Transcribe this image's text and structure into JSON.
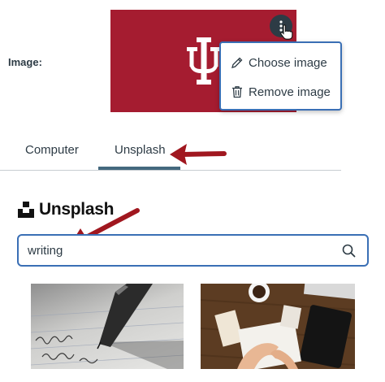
{
  "image_field": {
    "label": "Image:"
  },
  "preview": {
    "background_color": "#a51c30",
    "logo_icon": "iu-trident-logo"
  },
  "options_menu": {
    "trigger_icon": "kebab-icon",
    "items": [
      {
        "label": "Choose image",
        "icon": "pencil-icon"
      },
      {
        "label": "Remove image",
        "icon": "trash-icon"
      }
    ]
  },
  "tabs": [
    {
      "label": "Computer",
      "selected": false
    },
    {
      "label": "Unsplash",
      "selected": true
    }
  ],
  "unsplash": {
    "brand_name": "Unsplash",
    "search": {
      "value": "writing",
      "icon": "search-icon"
    },
    "results": [
      {
        "subject": "fountain pen writing on lined paper"
      },
      {
        "subject": "hands writing in notebook on wooden desk"
      }
    ]
  },
  "colors": {
    "accent": "#3a6fb5",
    "annotation_arrow": "#a0171f",
    "tab_indicator": "#44697e"
  }
}
